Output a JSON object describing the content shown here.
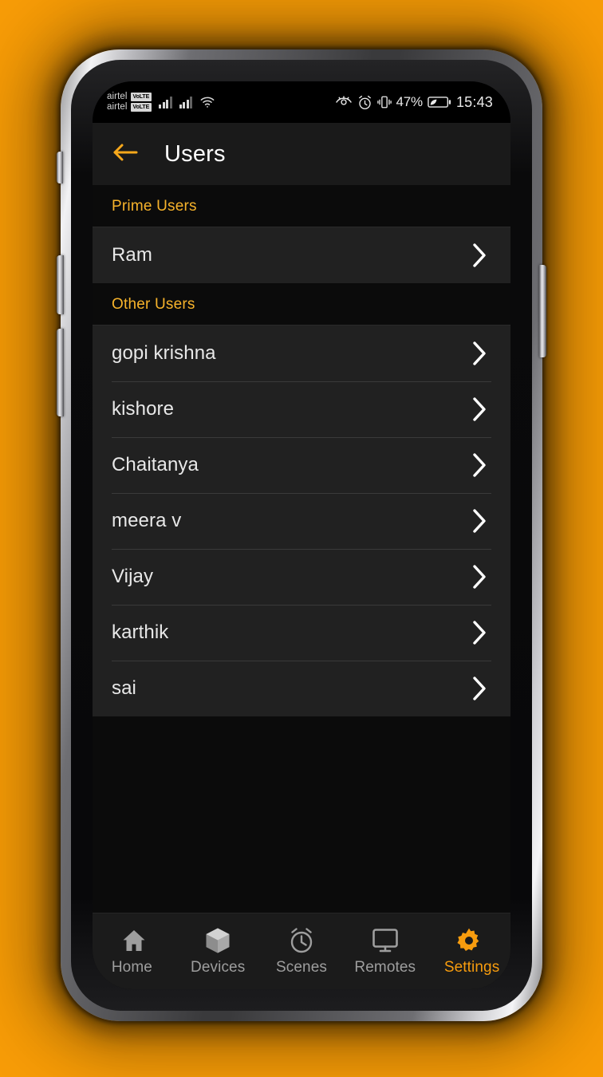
{
  "theme": {
    "backdrop": "#F99D07",
    "accent": "#F79C0E",
    "section_header_text": "#F7B32B",
    "row_bg": "#212121",
    "screen_bg": "#0b0b0b",
    "appbar_bg": "#1a1a1a"
  },
  "status_bar": {
    "carrier_1": "airtel",
    "carrier_2": "airtel",
    "volte_1": "VoLTE",
    "volte_2": "VoLTE",
    "icons": [
      "signal-bars-icon",
      "signal-bars-icon",
      "wifi-icon",
      "eye-icon",
      "alarm-icon",
      "vibrate-icon",
      "battery-saver-icon"
    ],
    "battery_percent": "47%",
    "clock": "15:43"
  },
  "app_bar": {
    "back_icon": "arrow-left-icon",
    "title": "Users"
  },
  "sections": [
    {
      "header": "Prime Users",
      "users": [
        {
          "name": "Ram",
          "chevron": "chevron-right-icon"
        }
      ]
    },
    {
      "header": "Other Users",
      "users": [
        {
          "name": "gopi krishna",
          "chevron": "chevron-right-icon"
        },
        {
          "name": "kishore",
          "chevron": "chevron-right-icon"
        },
        {
          "name": "Chaitanya",
          "chevron": "chevron-right-icon"
        },
        {
          "name": "meera v",
          "chevron": "chevron-right-icon"
        },
        {
          "name": "Vijay",
          "chevron": "chevron-right-icon"
        },
        {
          "name": "karthik",
          "chevron": "chevron-right-icon"
        },
        {
          "name": "sai",
          "chevron": "chevron-right-icon"
        }
      ]
    }
  ],
  "bottom_nav": {
    "items": [
      {
        "label": "Home",
        "icon": "home-icon",
        "active": false
      },
      {
        "label": "Devices",
        "icon": "cube-icon",
        "active": false
      },
      {
        "label": "Scenes",
        "icon": "alarm-icon",
        "active": false
      },
      {
        "label": "Remotes",
        "icon": "monitor-icon",
        "active": false
      },
      {
        "label": "Settings",
        "icon": "gear-icon",
        "active": true
      }
    ]
  }
}
